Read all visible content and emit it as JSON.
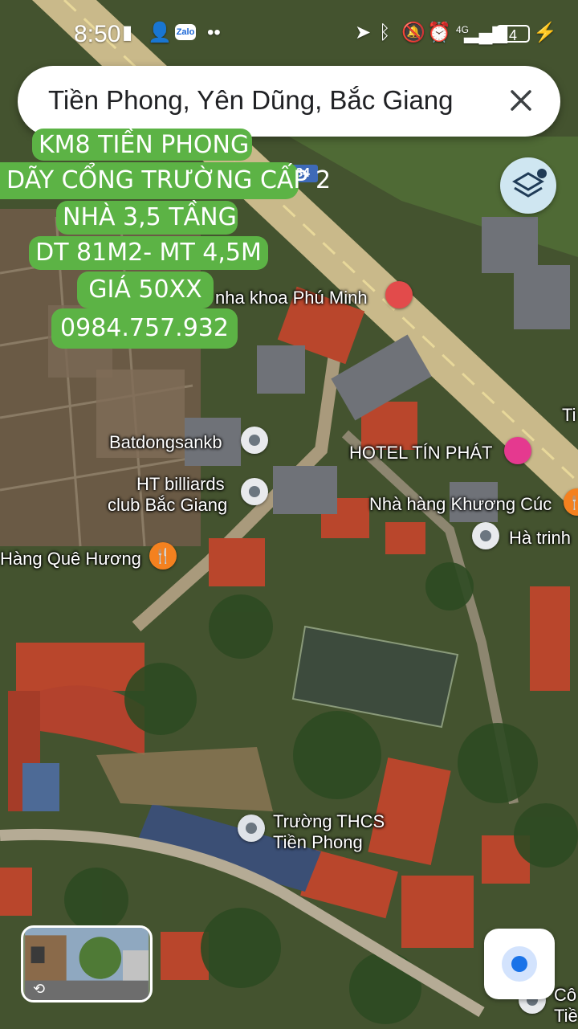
{
  "status_bar": {
    "time": "8:50",
    "network": "4G",
    "battery": "4"
  },
  "search": {
    "query": "Tiền Phong, Yên Dũng, Bắc Giang"
  },
  "ad_overlay": {
    "lines": [
      "KM8 TIỀN PHONG",
      "DÃY CỔNG TRƯỜNG CẤP 2",
      "NHÀ 3,5 TẦNG",
      "DT 81M2- MT 4,5M",
      "GIÁ 50XX",
      "0984.757.932"
    ]
  },
  "map": {
    "road_sign": "ĐT284",
    "places": {
      "dentist": "nha khoa Phú Minh",
      "batdongsan": "Batdongsankb",
      "billiards_1": "HT billiards",
      "billiards_2": "club Bắc Giang",
      "hotel": "HOTEL TÍN PHÁT",
      "restaurant_kc": "Nhà hàng Khương Cúc",
      "ha_trinh": "Hà trinh",
      "que_huong": "Hàng Quê Hương",
      "school_1": "Trường THCS",
      "school_2": "Tiền Phong",
      "edge_top": "Ti",
      "edge_bottom_1": "Cô",
      "edge_bottom_2": "Tiề"
    },
    "colors": {
      "road": "#c9b98a",
      "roof_red": "#c0462d",
      "vegetation": "#3b5a2a",
      "ad_green": "#5cb345"
    }
  }
}
